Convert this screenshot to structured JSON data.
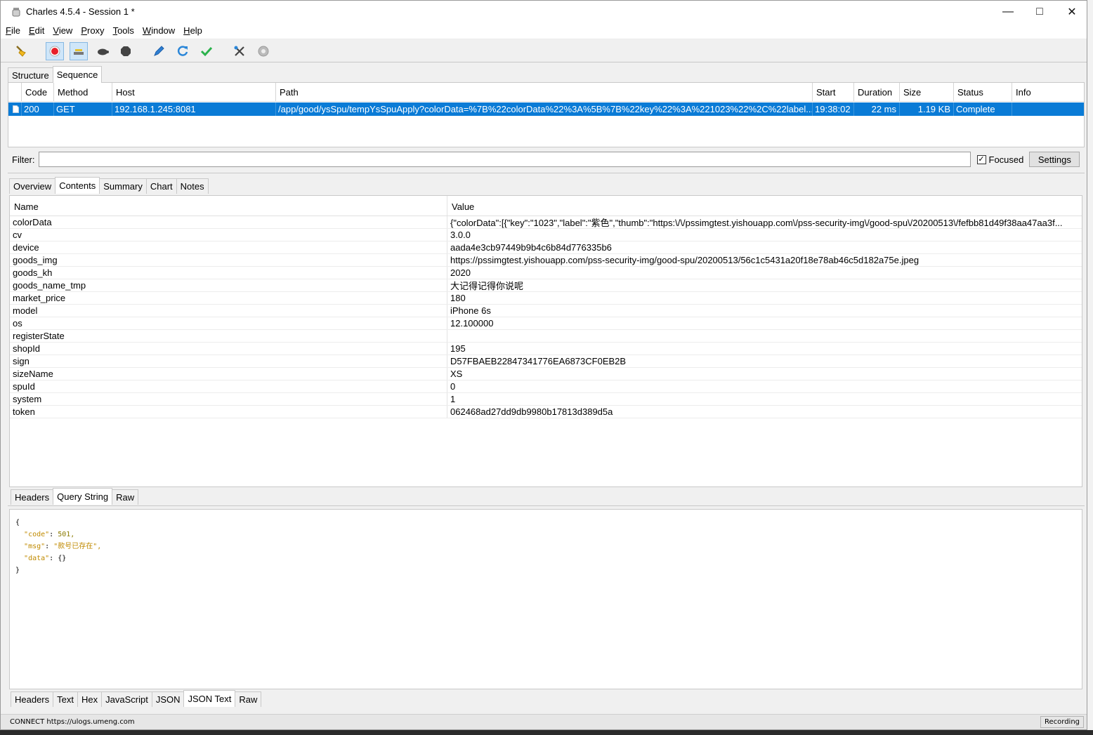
{
  "window": {
    "title": "Charles 4.5.4 - Session 1 *"
  },
  "menu": [
    "File",
    "Edit",
    "View",
    "Proxy",
    "Tools",
    "Window",
    "Help"
  ],
  "top_tabs": [
    "Structure",
    "Sequence"
  ],
  "sequence": {
    "headers": [
      "Code",
      "Method",
      "Host",
      "Path",
      "Start",
      "Duration",
      "Size",
      "Status",
      "Info"
    ],
    "row": {
      "code": "200",
      "method": "GET",
      "host": "192.168.1.245:8081",
      "path": "/app/good/ysSpu/tempYsSpuApply?colorData=%7B%22colorData%22%3A%5B%7B%22key%22%3A%221023%22%2C%22label...",
      "start": "19:38:02",
      "duration": "22 ms",
      "size": "1.19 KB",
      "status": "Complete",
      "info": ""
    }
  },
  "filter": {
    "label": "Filter:",
    "value": "",
    "focused_label": "Focused",
    "focused_checked": true,
    "settings_label": "Settings"
  },
  "detail_tabs": [
    "Overview",
    "Contents",
    "Summary",
    "Chart",
    "Notes"
  ],
  "params": {
    "name_header": "Name",
    "value_header": "Value",
    "rows": [
      {
        "name": "colorData",
        "value": "{\"colorData\":[{\"key\":\"1023\",\"label\":\"紫色\",\"thumb\":\"https:\\/\\/pssimgtest.yishouapp.com\\/pss-security-img\\/good-spu\\/20200513\\/fefbb81d49f38aa47aa3f..."
      },
      {
        "name": "cv",
        "value": "3.0.0"
      },
      {
        "name": "device",
        "value": "aada4e3cb97449b9b4c6b84d776335b6"
      },
      {
        "name": "goods_img",
        "value": "https://pssimgtest.yishouapp.com/pss-security-img/good-spu/20200513/56c1c5431a20f18e78ab46c5d182a75e.jpeg"
      },
      {
        "name": "goods_kh",
        "value": "2020"
      },
      {
        "name": "goods_name_tmp",
        "value": "大记得记得你说呢"
      },
      {
        "name": "market_price",
        "value": "180"
      },
      {
        "name": "model",
        "value": "iPhone 6s"
      },
      {
        "name": "os",
        "value": "12.100000"
      },
      {
        "name": "registerState",
        "value": ""
      },
      {
        "name": "shopId",
        "value": "195"
      },
      {
        "name": "sign",
        "value": "D57FBAEB22847341776EA6873CF0EB2B"
      },
      {
        "name": "sizeName",
        "value": "XS"
      },
      {
        "name": "spuId",
        "value": "0"
      },
      {
        "name": "system",
        "value": "1"
      },
      {
        "name": "token",
        "value": "062468ad27dd9db9980b17813d389d5a"
      }
    ]
  },
  "request_tabs": [
    "Headers",
    "Query String",
    "Raw"
  ],
  "response": {
    "open": "{",
    "code_key": "\"code\"",
    "code_val": "501,",
    "msg_key": "\"msg\"",
    "msg_val": "\"款号已存在\",",
    "data_key": "\"data\"",
    "data_val": "{}",
    "close": "}"
  },
  "response_tabs": [
    "Headers",
    "Text",
    "Hex",
    "JavaScript",
    "JSON",
    "JSON Text",
    "Raw"
  ],
  "status": {
    "text": "CONNECT https://ulogs.umeng.com",
    "recording": "Recording"
  },
  "colors": {
    "selection": "#0a7bd6",
    "json_key": "#c08a00"
  }
}
